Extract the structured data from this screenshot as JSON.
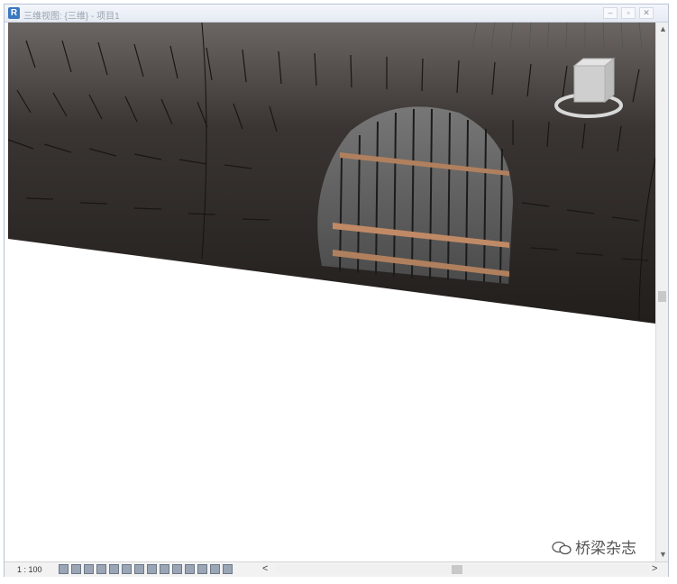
{
  "window": {
    "title": "三维视图: {三维} - 项目1",
    "app_icon": "revit-icon",
    "controls": [
      "minimize-icon",
      "restore-icon",
      "close-icon"
    ]
  },
  "viewport": {
    "background": "#ffffff",
    "model_color": "#2b2623",
    "rebar_color": "#b0805e",
    "view_cube": "view-cube-icon"
  },
  "statusbar": {
    "scale": "1 : 100",
    "tool_icons": [
      "detail-level-icon",
      "visual-style-icon",
      "sun-path-icon",
      "shadows-icon",
      "render-icon",
      "crop-icon",
      "crop-visibility-icon",
      "lock-3d-icon",
      "temporary-hide-icon",
      "reveal-hidden-icon",
      "temp-view-props-icon",
      "analytical-model-icon",
      "highlight-displacement-icon",
      "worksharing-icon"
    ],
    "left_chevron": "<",
    "right_chevron": ">"
  },
  "watermark": {
    "text": "桥梁杂志",
    "logo": "wechat-icon"
  }
}
